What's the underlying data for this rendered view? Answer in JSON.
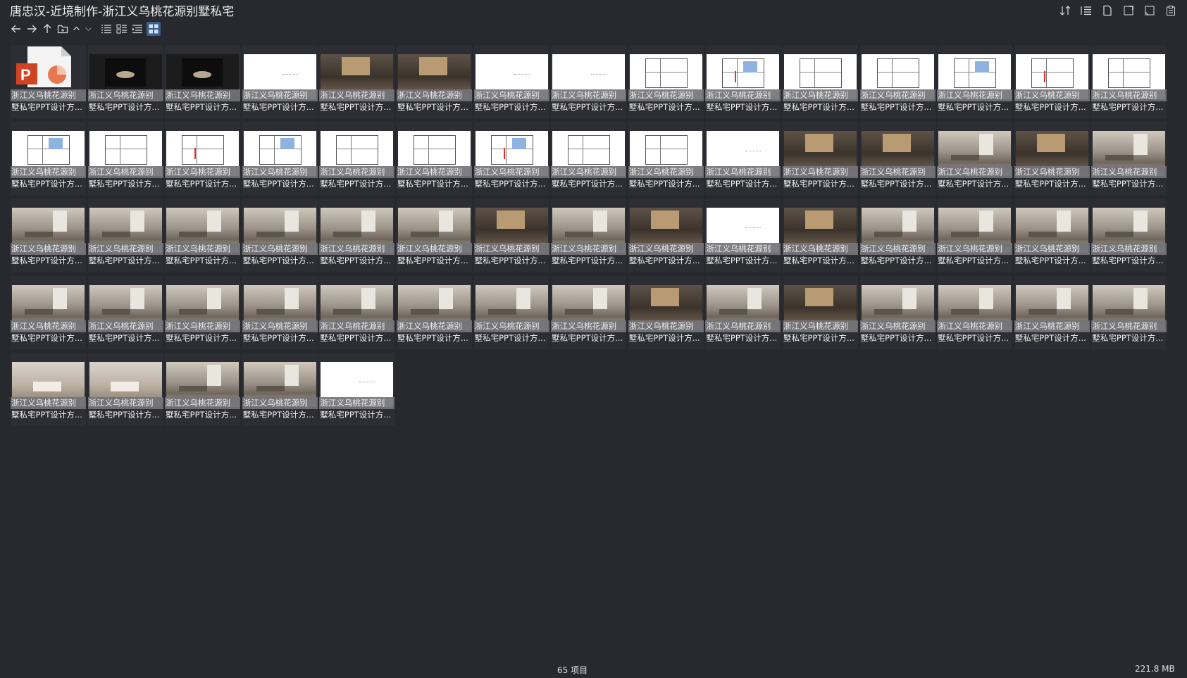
{
  "window": {
    "title": "唐忠汉-近境制作-浙江义乌桃花源别墅私宅"
  },
  "toolbar": {
    "left_icons": [
      "back-arrow-icon",
      "forward-arrow-icon",
      "up-arrow-icon",
      "new-folder-icon",
      "chevron-up-icon",
      "chevron-down-icon",
      "list-view-icon",
      "details-view-icon",
      "tree-view-icon",
      "thumbnail-view-icon"
    ],
    "right_icons": [
      "sort-icon",
      "column-options-icon",
      "file-icon",
      "expand-icon",
      "window-icon",
      "clipboard-icon"
    ]
  },
  "files": {
    "caption_line1": "浙江义乌桃花源别",
    "caption_line2": "墅私宅PPT设计方...",
    "items": [
      {
        "kind": "ppt"
      },
      {
        "kind": "dark"
      },
      {
        "kind": "dark"
      },
      {
        "kind": "white"
      },
      {
        "kind": "roomd"
      },
      {
        "kind": "roomd"
      },
      {
        "kind": "white"
      },
      {
        "kind": "white"
      },
      {
        "kind": "plan"
      },
      {
        "kind": "plan"
      },
      {
        "kind": "plan"
      },
      {
        "kind": "plan"
      },
      {
        "kind": "plan"
      },
      {
        "kind": "plan"
      },
      {
        "kind": "plan"
      },
      {
        "kind": "plan"
      },
      {
        "kind": "plan"
      },
      {
        "kind": "plan"
      },
      {
        "kind": "plan"
      },
      {
        "kind": "plan"
      },
      {
        "kind": "plan"
      },
      {
        "kind": "plan"
      },
      {
        "kind": "plan"
      },
      {
        "kind": "plan"
      },
      {
        "kind": "white"
      },
      {
        "kind": "roomd"
      },
      {
        "kind": "roomd"
      },
      {
        "kind": "room"
      },
      {
        "kind": "roomd"
      },
      {
        "kind": "room"
      },
      {
        "kind": "room"
      },
      {
        "kind": "room"
      },
      {
        "kind": "room"
      },
      {
        "kind": "room"
      },
      {
        "kind": "room"
      },
      {
        "kind": "room"
      },
      {
        "kind": "roomd"
      },
      {
        "kind": "room"
      },
      {
        "kind": "roomd"
      },
      {
        "kind": "white"
      },
      {
        "kind": "roomd"
      },
      {
        "kind": "room"
      },
      {
        "kind": "room"
      },
      {
        "kind": "room"
      },
      {
        "kind": "room"
      },
      {
        "kind": "room"
      },
      {
        "kind": "room"
      },
      {
        "kind": "room"
      },
      {
        "kind": "room"
      },
      {
        "kind": "room"
      },
      {
        "kind": "room"
      },
      {
        "kind": "room"
      },
      {
        "kind": "room"
      },
      {
        "kind": "roomd"
      },
      {
        "kind": "room"
      },
      {
        "kind": "roomd"
      },
      {
        "kind": "room"
      },
      {
        "kind": "room"
      },
      {
        "kind": "room"
      },
      {
        "kind": "room"
      },
      {
        "kind": "bed"
      },
      {
        "kind": "bed"
      },
      {
        "kind": "room"
      },
      {
        "kind": "room"
      },
      {
        "kind": "white"
      }
    ]
  },
  "status": {
    "count": "65 项目",
    "size": "221.8 MB"
  }
}
